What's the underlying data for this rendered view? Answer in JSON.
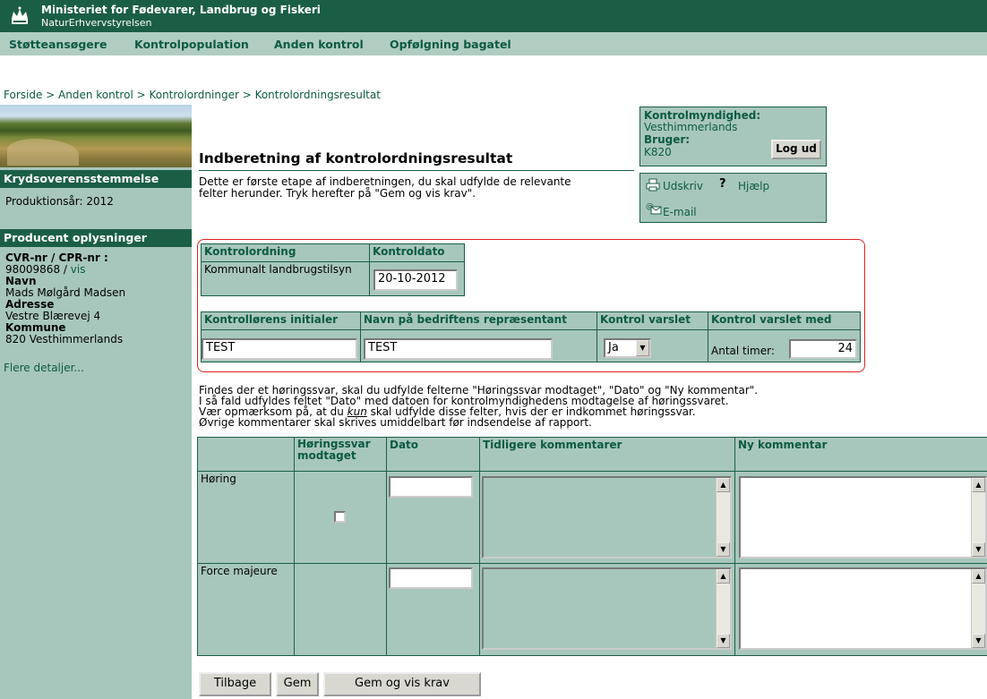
{
  "header": {
    "ministry": "Ministeriet for Fødevarer, Landbrug og Fiskeri",
    "agency": "NaturErhvervstyrelsen"
  },
  "nav": [
    "Støtteansøgere",
    "Kontrolpopulation",
    "Anden kontrol",
    "Opfølgning bagatel"
  ],
  "breadcrumb": "Forside > Anden kontrol > Kontrolordninger > Kontrolordningsresultat",
  "sidebar": {
    "section1_title": "Krydsoverensstemmelse",
    "production_year": "Produktionsår: 2012",
    "section2_title": "Producent oplysninger",
    "cvr_label": "CVR-nr / CPR-nr :",
    "cvr_value": "98009868 /",
    "cvr_link": "vis",
    "name_label": "Navn",
    "name_value": "Mads Mølgård Madsen",
    "address_label": "Adresse",
    "address_value": "Vestre Blærevej 4",
    "municipality_label": "Kommune",
    "municipality_value": "820 Vesthimmerlands",
    "more_link": "Flere detaljer..."
  },
  "page": {
    "title": "Indberetning af kontrolordningsresultat",
    "intro_line1": "Dette er første etape af indberetningen, du skal udfylde de relevante",
    "intro_line2": "felter herunder. Tryk herefter på \"Gem og vis krav\"."
  },
  "authority_box": {
    "authority_label": "Kontrolmyndighed:",
    "authority_value": "Vesthimmerlands",
    "user_label": "Bruger:",
    "user_value": "K820",
    "logout_button": "Log ud"
  },
  "utility_box": {
    "print": "Udskriv",
    "help": "Hjælp",
    "email": "E-mail"
  },
  "control_table": {
    "col_scheme": "Kontrolordning",
    "col_date": "Kontroldato",
    "scheme_value": "Kommunalt landbrugstilsyn",
    "date_value": "20-10-2012"
  },
  "inspector_table": {
    "col_initials": "Kontrollørens initialer",
    "col_representative": "Navn på bedriftens repræsentant",
    "col_notified": "Kontrol varslet",
    "col_notified_with": "Kontrol varslet med",
    "initials_value": "TEST",
    "representative_value": "TEST",
    "notified_value": "Ja",
    "hours_label": "Antal timer:",
    "hours_value": "24"
  },
  "hearing_note": {
    "line1": "Findes der et høringssvar, skal du udfylde felterne \"Høringssvar modtaget\", \"Dato\" og \"Ny kommentar\".",
    "line2": "I så fald udfyldes feltet \"Dato\" med datoen for kontrolmyndighedens modtagelse af høringssvaret.",
    "line3_pre": "Vær opmærksom på, at du ",
    "line3_em": "kun",
    "line3_post": " skal udfylde disse felter, hvis der er indkommet høringssvar.",
    "line4": "Øvrige kommentarer skal skrives umiddelbart før indsendelse af rapport."
  },
  "comments_table": {
    "col_received_line1": "Høringssvar",
    "col_received_line2": "modtaget",
    "col_date": "Dato",
    "col_previous": "Tidligere kommentarer",
    "col_new": "Ny kommentar",
    "rows": [
      "Høring",
      "Force majeure"
    ]
  },
  "buttons": {
    "back": "Tilbage",
    "save": "Gem",
    "save_show": "Gem og vis krav"
  },
  "colors": {
    "dark_green": "#1b5e46",
    "light_green": "#a8c7bc",
    "frame_red": "#dd2222"
  }
}
